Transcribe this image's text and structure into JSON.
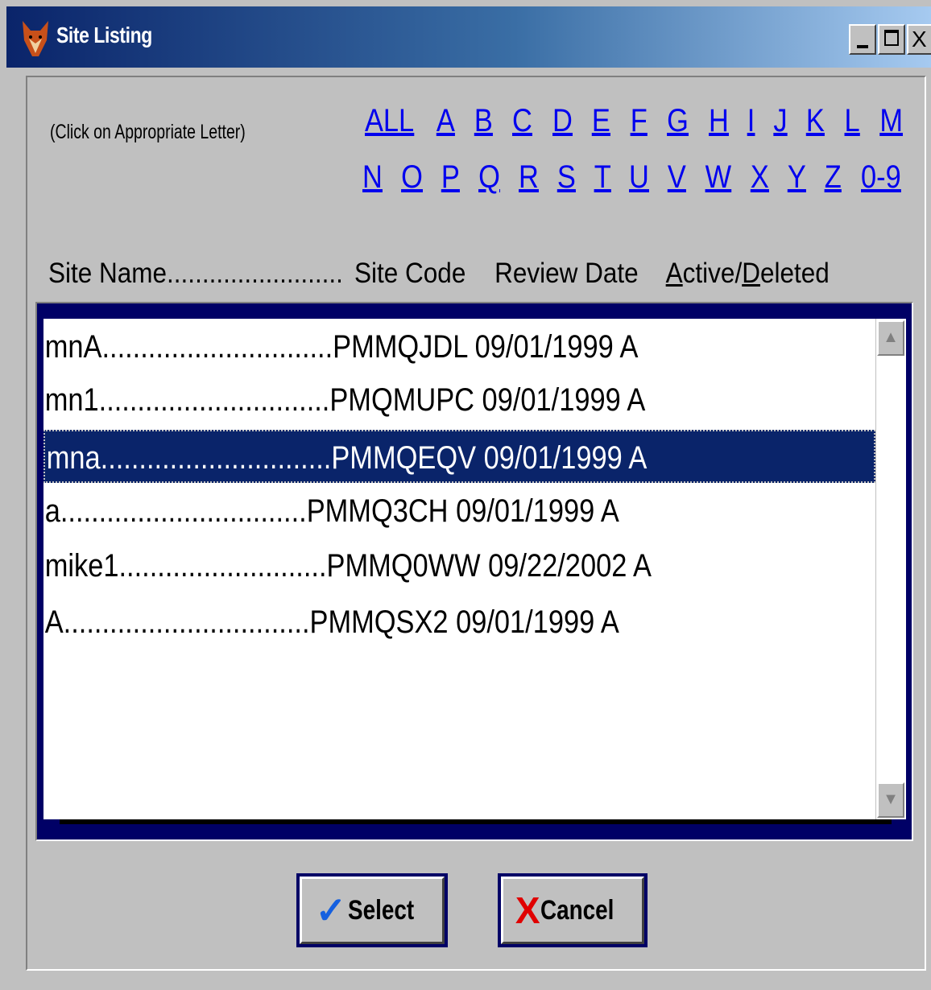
{
  "window": {
    "title": "Site Listing",
    "icon": "fox-icon",
    "controls": {
      "minimize": "_",
      "maximize": "□",
      "close": "X"
    }
  },
  "filter": {
    "hint": "(Click on Appropriate Letter)",
    "row1": [
      "ALL",
      "A",
      "B",
      "C",
      "D",
      "E",
      "F",
      "G",
      "H",
      "I",
      "J",
      "K",
      "L",
      "M"
    ],
    "row2": [
      "N",
      "O",
      "P",
      "Q",
      "R",
      "S",
      "T",
      "U",
      "V",
      "W",
      "X",
      "Y",
      "Z",
      "0-9"
    ]
  },
  "list": {
    "header": {
      "site_name": "Site Name.........................",
      "site_code": "Site Code",
      "review_date": "Review Date",
      "active_a": "A",
      "active_rest": "ctive/",
      "deleted_d": "D",
      "deleted_rest": "eleted"
    },
    "rows": [
      "mnA..............................PMMQJDL  09/01/1999  A",
      "mn1..............................PMQMUPC  09/01/1999  A",
      "mna..............................PMMQEQV  09/01/1999  A",
      "a................................PMMQ3CH  09/01/1999  A",
      "mike1...........................PMMQ0WW  09/22/2002  A",
      "A................................PMMQSX2  09/01/1999  A"
    ],
    "selected_index": 2
  },
  "buttons": {
    "select_icon": "✓",
    "select_label": "Select",
    "cancel_icon": "X",
    "cancel_label": "Cancel"
  },
  "colors": {
    "selection": "#0a246a",
    "link": "#0000ee",
    "frame": "#000066",
    "face": "#c0c0c0"
  }
}
